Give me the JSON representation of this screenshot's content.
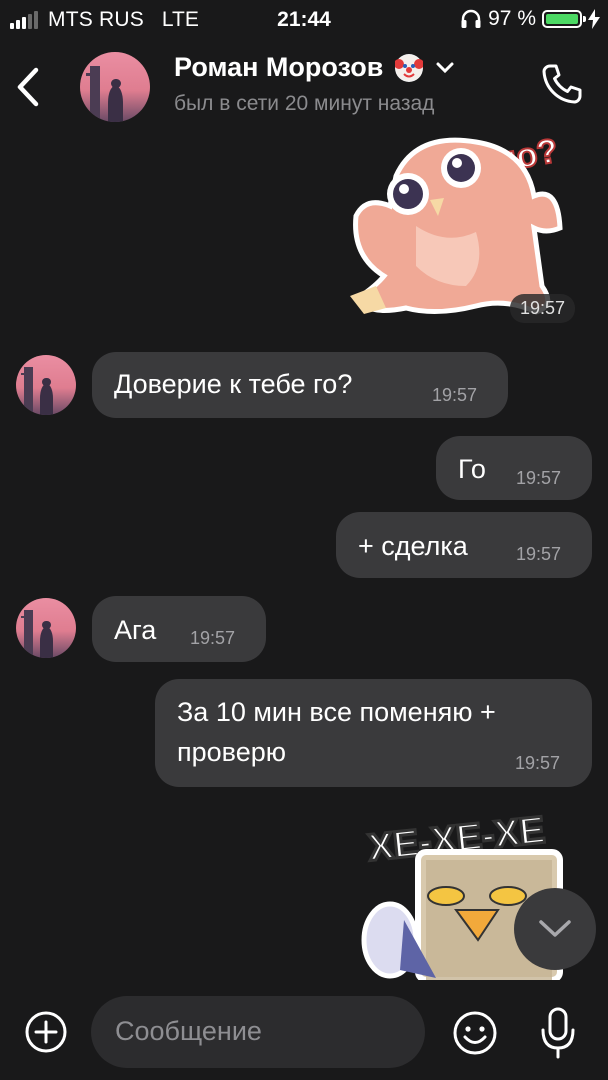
{
  "status_bar": {
    "carrier": "MTS RUS",
    "network": "LTE",
    "time": "21:44",
    "battery": "97 %"
  },
  "header": {
    "name": "Роман Морозов",
    "status": "был в сети 20 минут назад",
    "name_emoji": "clown-face-icon"
  },
  "messages": [
    {
      "type": "sticker",
      "side": "outgoing",
      "sticker": "owl-sticker",
      "sticker_text": "но?",
      "time": "19:57"
    },
    {
      "type": "text",
      "side": "incoming",
      "text": "Доверие к тебе го?",
      "time": "19:57"
    },
    {
      "type": "text",
      "side": "outgoing",
      "text": "Го",
      "time": "19:57"
    },
    {
      "type": "text",
      "side": "outgoing",
      "text": "+ сделка",
      "time": "19:57"
    },
    {
      "type": "text",
      "side": "incoming",
      "text": "Ага",
      "time": "19:57"
    },
    {
      "type": "text",
      "side": "outgoing",
      "text_line1": "За 10 мин все поменяю +",
      "text_line2": "проверю",
      "time": "19:57"
    },
    {
      "type": "sticker",
      "side": "outgoing",
      "sticker": "seagull-in-glass-sticker",
      "sticker_text": "ХЕ-ХЕ-ХЕ"
    }
  ],
  "composer": {
    "placeholder": "Сообщение"
  },
  "colors": {
    "background": "#19191a",
    "bubble": "#3a3a3c",
    "accent_battery": "#4cd964",
    "secondary_text": "#8b8b8e"
  }
}
